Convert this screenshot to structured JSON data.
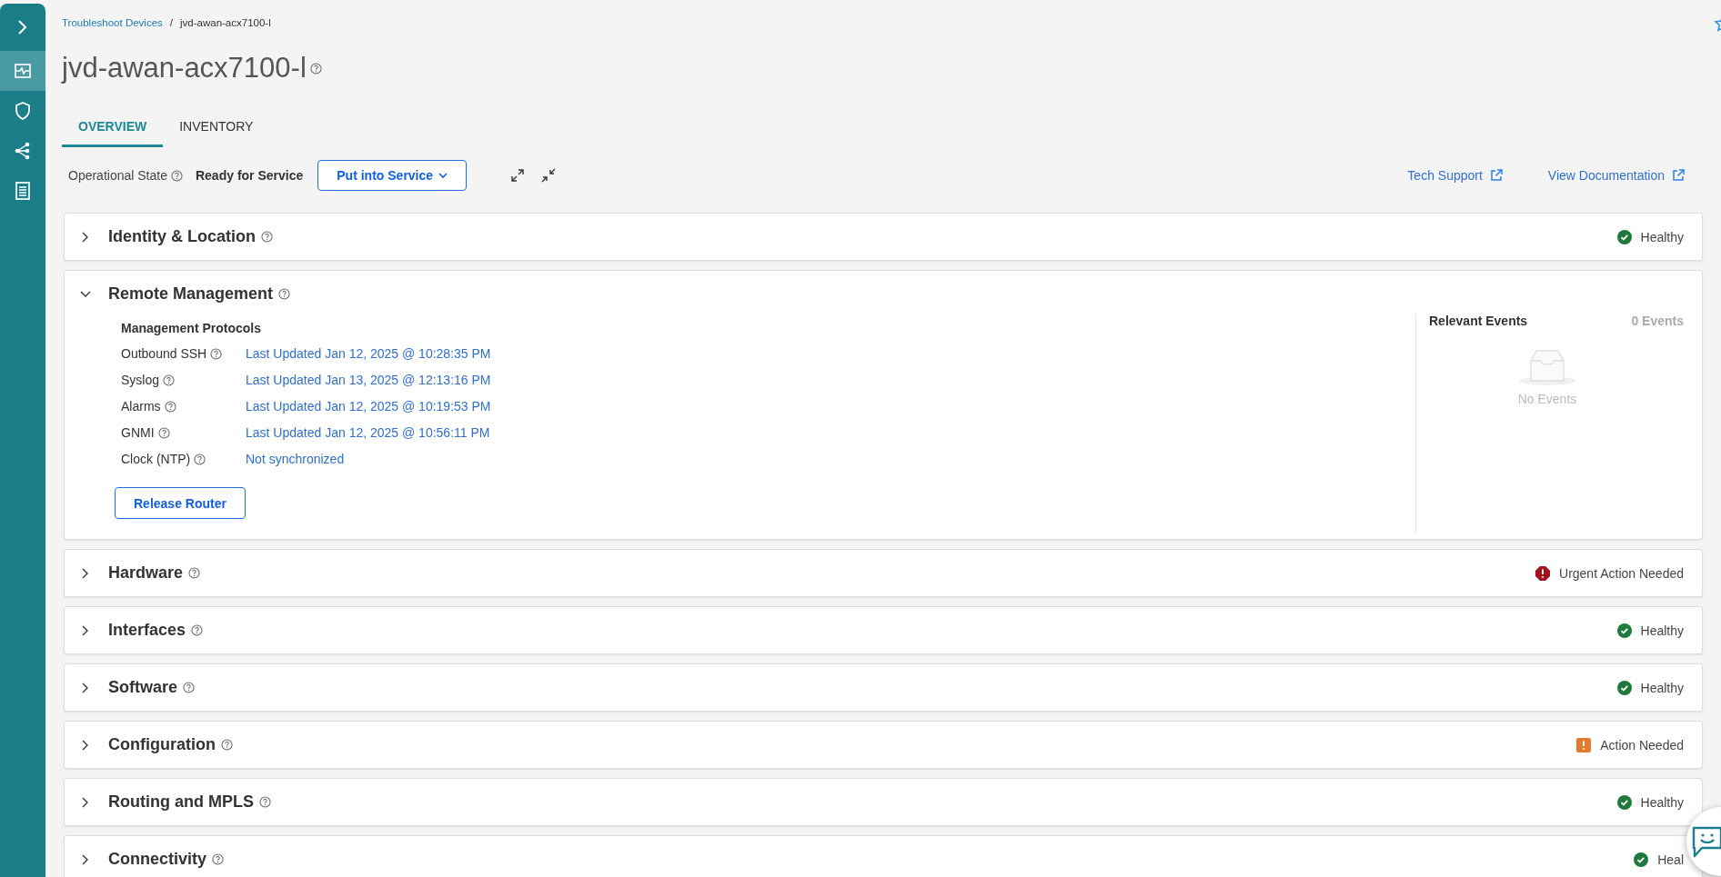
{
  "sidebar": {
    "items": [
      {
        "selected": true
      },
      {
        "selected": false
      },
      {
        "selected": false
      },
      {
        "selected": false
      }
    ]
  },
  "breadcrumb": [
    {
      "text": "Troubleshoot Devices",
      "link": true
    },
    {
      "text": "/",
      "link": false
    },
    {
      "text": "jvd-awan-acx7100-l",
      "link": false
    }
  ],
  "title": "jvd-awan-acx7100-l",
  "tabs": [
    {
      "label": "OVERVIEW",
      "selected": true
    },
    {
      "label": "INVENTORY",
      "selected": false
    }
  ],
  "toolbar": {
    "state_label": "Operational State",
    "state_value": "Ready for Service",
    "action": "Put into Service",
    "links": [
      "Tech Support",
      "View Documentation"
    ]
  },
  "sections": [
    {
      "title": "Identity & Location",
      "expanded": false,
      "status": {
        "kind": "healthy",
        "text": "Healthy"
      }
    },
    {
      "title": "Remote Management",
      "expanded": true,
      "protocols_title": "Management Protocols",
      "protocols": [
        {
          "name": "Outbound SSH",
          "value": "Last Updated Jan 12, 2025 @ 10:28:35 PM"
        },
        {
          "name": "Syslog",
          "value": "Last Updated Jan 13, 2025 @ 12:13:16 PM"
        },
        {
          "name": "Alarms",
          "value": "Last Updated Jan 12, 2025 @ 10:19:53 PM"
        },
        {
          "name": "GNMI",
          "value": "Last Updated Jan 12, 2025 @ 10:56:11 PM"
        },
        {
          "name": "Clock (NTP)",
          "value": "Not synchronized"
        }
      ],
      "button": "Release Router",
      "events": {
        "title": "Relevant Events",
        "count": "0 Events",
        "empty": "No Events"
      }
    },
    {
      "title": "Hardware",
      "expanded": false,
      "status": {
        "kind": "urgent",
        "text": "Urgent Action Needed"
      }
    },
    {
      "title": "Interfaces",
      "expanded": false,
      "status": {
        "kind": "healthy",
        "text": "Healthy"
      }
    },
    {
      "title": "Software",
      "expanded": false,
      "status": {
        "kind": "healthy",
        "text": "Healthy"
      }
    },
    {
      "title": "Configuration",
      "expanded": false,
      "status": {
        "kind": "action",
        "text": "Action Needed"
      }
    },
    {
      "title": "Routing and MPLS",
      "expanded": false,
      "status": {
        "kind": "healthy",
        "text": "Healthy"
      }
    },
    {
      "title": "Connectivity",
      "expanded": false,
      "status": {
        "kind": "healthy",
        "text": "Heal"
      }
    }
  ]
}
